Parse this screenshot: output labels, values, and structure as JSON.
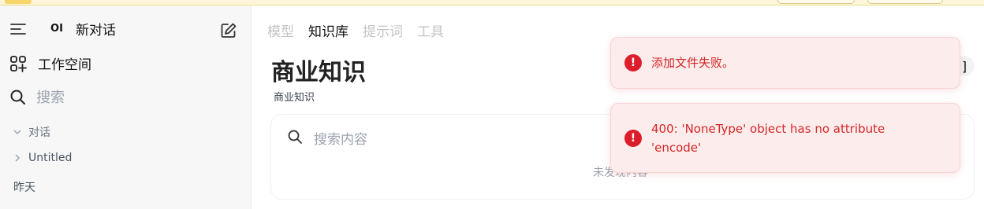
{
  "sidebar": {
    "new_chat_logo": "OI",
    "new_chat_label": "新对话",
    "workspace_label": "工作空间",
    "search_placeholder": "搜索",
    "groups": [
      {
        "label": "对话",
        "expanded": true
      },
      {
        "label": "Untitled",
        "expanded": false
      }
    ],
    "date_header": "昨天"
  },
  "main": {
    "tabs": [
      {
        "label": "模型",
        "active": false
      },
      {
        "label": "知识库",
        "active": true
      },
      {
        "label": "提示词",
        "active": false
      },
      {
        "label": "工具",
        "active": false
      }
    ],
    "title": "商业知识",
    "subtitle": "商业知识",
    "right_button_glyph": "]",
    "content": {
      "search_placeholder": "搜索内容",
      "empty_text": "未发现内容"
    }
  },
  "toasts": [
    {
      "message": "添加文件失败。",
      "type": "error"
    },
    {
      "message": "400: 'NoneType' object has no attribute 'encode'",
      "type": "error"
    }
  ],
  "colors": {
    "error_red": "#dc1e2a",
    "toast_bg": "#fdecec",
    "sidebar_bg": "#f7f7f7",
    "topbar_bg": "#fdf6d8"
  },
  "icons": {
    "menu": "menu-icon",
    "edit": "edit-icon",
    "workspace": "grid-plus-icon",
    "search": "search-icon",
    "error": "error-circle-icon"
  }
}
